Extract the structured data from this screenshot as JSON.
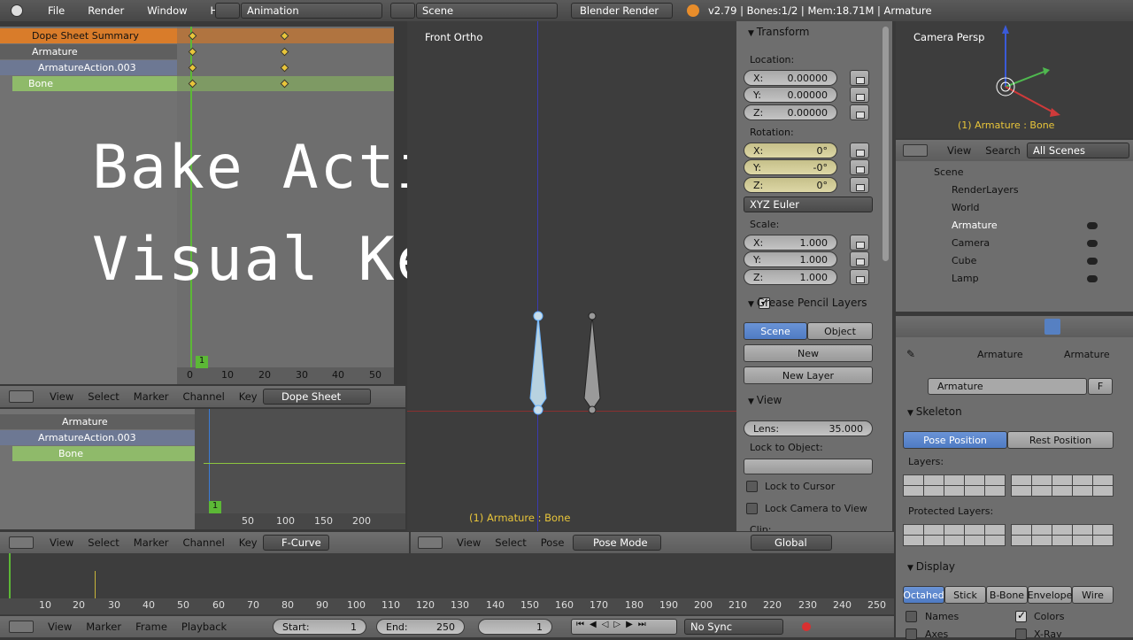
{
  "topbar": {
    "menus": [
      "File",
      "Render",
      "Window",
      "Help"
    ],
    "screen_layout": "Animation",
    "scene": "Scene",
    "engine": "Blender Render",
    "status": "v2.79 | Bones:1/2 | Mem:18.71M | Armature"
  },
  "dopesheet_top": {
    "channels": [
      "Dope Sheet Summary",
      "Armature",
      "ArmatureAction.003",
      "Bone"
    ],
    "ticks": [
      "0",
      "10",
      "20",
      "30",
      "40",
      "50"
    ],
    "frame": "1"
  },
  "overlay": {
    "line1": "Bake Action :",
    "line2": "Visual Keying"
  },
  "dopesheet_header": {
    "items": [
      "View",
      "Select",
      "Marker",
      "Channel",
      "Key"
    ],
    "mode": "Dope Sheet"
  },
  "graph": {
    "channels": [
      "Armature",
      "ArmatureAction.003",
      "Bone"
    ],
    "ticks": [
      "50",
      "100",
      "150",
      "200"
    ],
    "frame": "1"
  },
  "graph_header": {
    "items": [
      "View",
      "Select",
      "Marker",
      "Channel",
      "Key"
    ],
    "mode": "F-Curve"
  },
  "viewport": {
    "label": "Front Ortho",
    "object_label": "(1) Armature : Bone",
    "header_items": [
      "View",
      "Select",
      "Pose"
    ],
    "mode": "Pose Mode",
    "orientation": "Global"
  },
  "npanel": {
    "transform": "Transform",
    "location_label": "Location:",
    "location": [
      {
        "axis": "X:",
        "val": "0.00000"
      },
      {
        "axis": "Y:",
        "val": "0.00000"
      },
      {
        "axis": "Z:",
        "val": "0.00000"
      }
    ],
    "rotation_label": "Rotation:",
    "rotation": [
      {
        "axis": "X:",
        "val": "0°"
      },
      {
        "axis": "Y:",
        "val": "-0°"
      },
      {
        "axis": "Z:",
        "val": "0°"
      }
    ],
    "rotation_mode": "XYZ Euler",
    "scale_label": "Scale:",
    "scale": [
      {
        "axis": "X:",
        "val": "1.000"
      },
      {
        "axis": "Y:",
        "val": "1.000"
      },
      {
        "axis": "Z:",
        "val": "1.000"
      }
    ],
    "grease_pencil": "Grease Pencil Layers",
    "gp_scene": "Scene",
    "gp_object": "Object",
    "gp_new": "New",
    "gp_new_layer": "New Layer",
    "view": "View",
    "lens_label": "Lens:",
    "lens": "35.000",
    "lock_object": "Lock to Object:",
    "lock_cursor": "Lock to Cursor",
    "lock_camera": "Lock Camera to View",
    "clip": "Clip:"
  },
  "camview": {
    "label": "Camera Persp",
    "object_label": "(1) Armature : Bone"
  },
  "outliner": {
    "header_items": [
      "View",
      "Search"
    ],
    "filter": "All Scenes",
    "items": [
      "Scene",
      "RenderLayers",
      "World",
      "Armature",
      "Camera",
      "Cube",
      "Lamp"
    ]
  },
  "props": {
    "breadcrumb1": "Armature",
    "breadcrumb2": "Armature",
    "name": "Armature",
    "fake": "F",
    "skeleton": "Skeleton",
    "pose_position": "Pose Position",
    "rest_position": "Rest Position",
    "layers": "Layers:",
    "protected_layers": "Protected Layers:",
    "display": "Display",
    "display_modes": [
      "Octahed",
      "Stick",
      "B-Bone",
      "Envelope",
      "Wire"
    ],
    "names": "Names",
    "colors": "Colors",
    "axes": "Axes",
    "xray": "X-Ray"
  },
  "timeline": {
    "ticks": [
      "10",
      "20",
      "30",
      "40",
      "50",
      "60",
      "70",
      "80",
      "90",
      "100",
      "110",
      "120",
      "130",
      "140",
      "150",
      "160",
      "170",
      "180",
      "190",
      "200",
      "210",
      "220",
      "230",
      "240",
      "250"
    ],
    "header_items": [
      "View",
      "Marker",
      "Frame",
      "Playback"
    ],
    "start_label": "Start:",
    "start": "1",
    "end_label": "End:",
    "end": "250",
    "current": "1",
    "sync": "No Sync"
  }
}
